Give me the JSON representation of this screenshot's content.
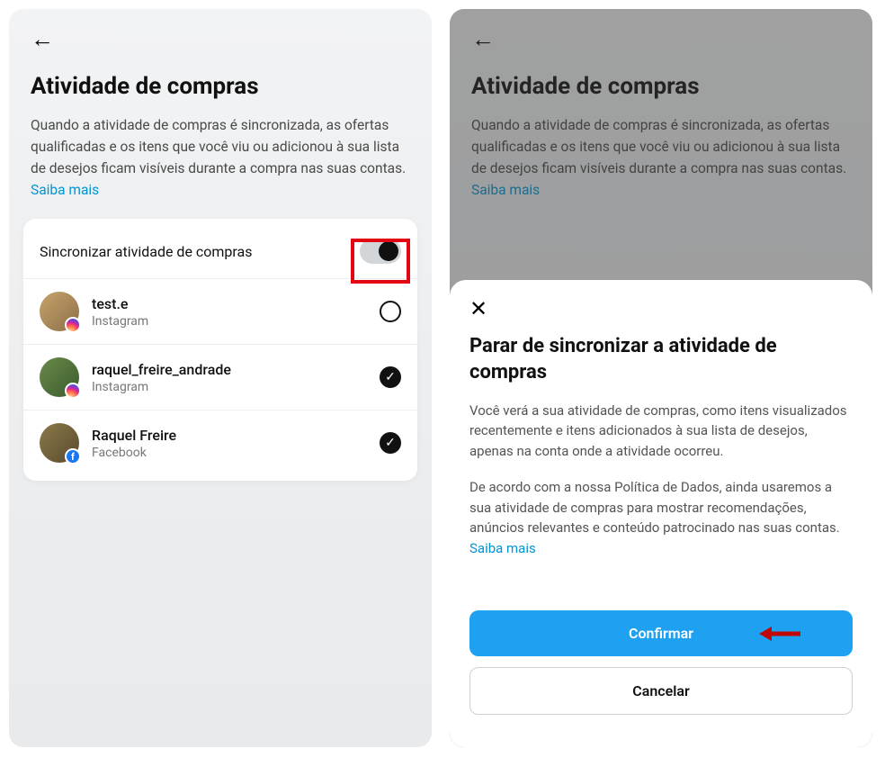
{
  "screen1": {
    "title": "Atividade de compras",
    "description_prefix": "Quando a atividade de compras é sincronizada, as ofertas qualificadas e os itens que você viu ou adicionou à sua lista de desejos ficam visíveis durante a compra nas suas contas. ",
    "learn_more": "Saiba mais",
    "toggle_label": "Sincronizar atividade de compras",
    "accounts": [
      {
        "name": "test.e",
        "platform": "Instagram",
        "badge": "ig",
        "checked": false
      },
      {
        "name": "raquel_freire_andrade",
        "platform": "Instagram",
        "badge": "ig",
        "checked": true
      },
      {
        "name": "Raquel Freire",
        "platform": "Facebook",
        "badge": "fb",
        "checked": true
      }
    ]
  },
  "screen2": {
    "title": "Atividade de compras",
    "description_prefix": "Quando a atividade de compras é sincronizada, as ofertas qualificadas e os itens que você viu ou adicionou à sua lista de desejos ficam visíveis durante a compra nas suas contas. ",
    "learn_more": "Saiba mais"
  },
  "sheet": {
    "title": "Parar de sincronizar a atividade de compras",
    "p1": "Você verá a sua atividade de compras, como itens visualizados recentemente e itens adicionados à sua lista de desejos, apenas na conta onde a atividade ocorreu.",
    "p2_prefix": "De acordo com a nossa Política de Dados, ainda usaremos a sua atividade de compras para mostrar recomendações, anúncios relevantes e conteúdo patrocinado nas suas contas. ",
    "learn_more": "Saiba mais",
    "confirm": "Confirmar",
    "cancel": "Cancelar"
  }
}
